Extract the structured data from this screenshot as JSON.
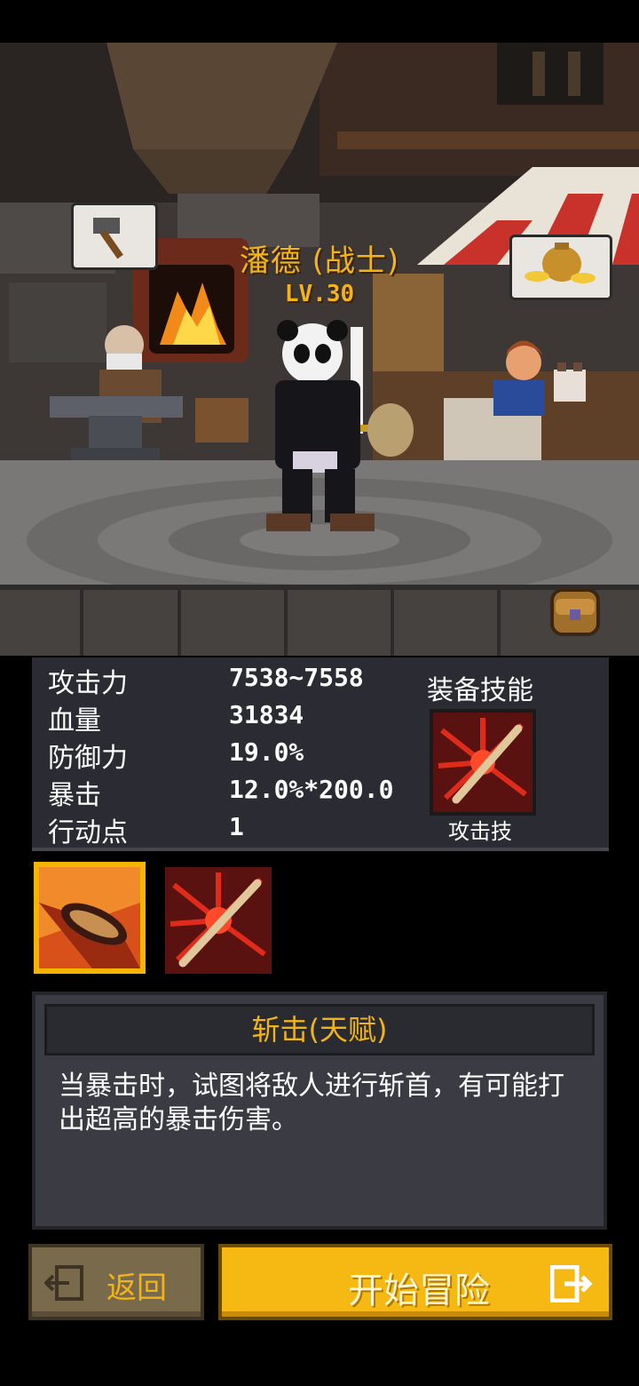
{
  "character": {
    "name": "潘德 (战士)",
    "level": "LV.30"
  },
  "stats": {
    "rows": [
      {
        "label": "攻击力",
        "value": "7538~7558"
      },
      {
        "label": "血量",
        "value": "31834"
      },
      {
        "label": "防御力",
        "value": "19.0%"
      },
      {
        "label": "暴击",
        "value": "12.0%*200.0"
      },
      {
        "label": "行动点",
        "value": "1"
      }
    ],
    "equip_title": "装备技能",
    "equip_skill_name": "攻击技"
  },
  "skill_detail": {
    "title": "斩击(天赋)",
    "description": "当暴击时，试图将敌人进行斩首，有可能打出超高的暴击伤害。"
  },
  "buttons": {
    "back_label": "返回",
    "start_label": "开始冒险"
  },
  "colors": {
    "accent_gold": "#f2b418",
    "panel_dark": "#2b2c33",
    "button_yellow": "#f6b812"
  }
}
